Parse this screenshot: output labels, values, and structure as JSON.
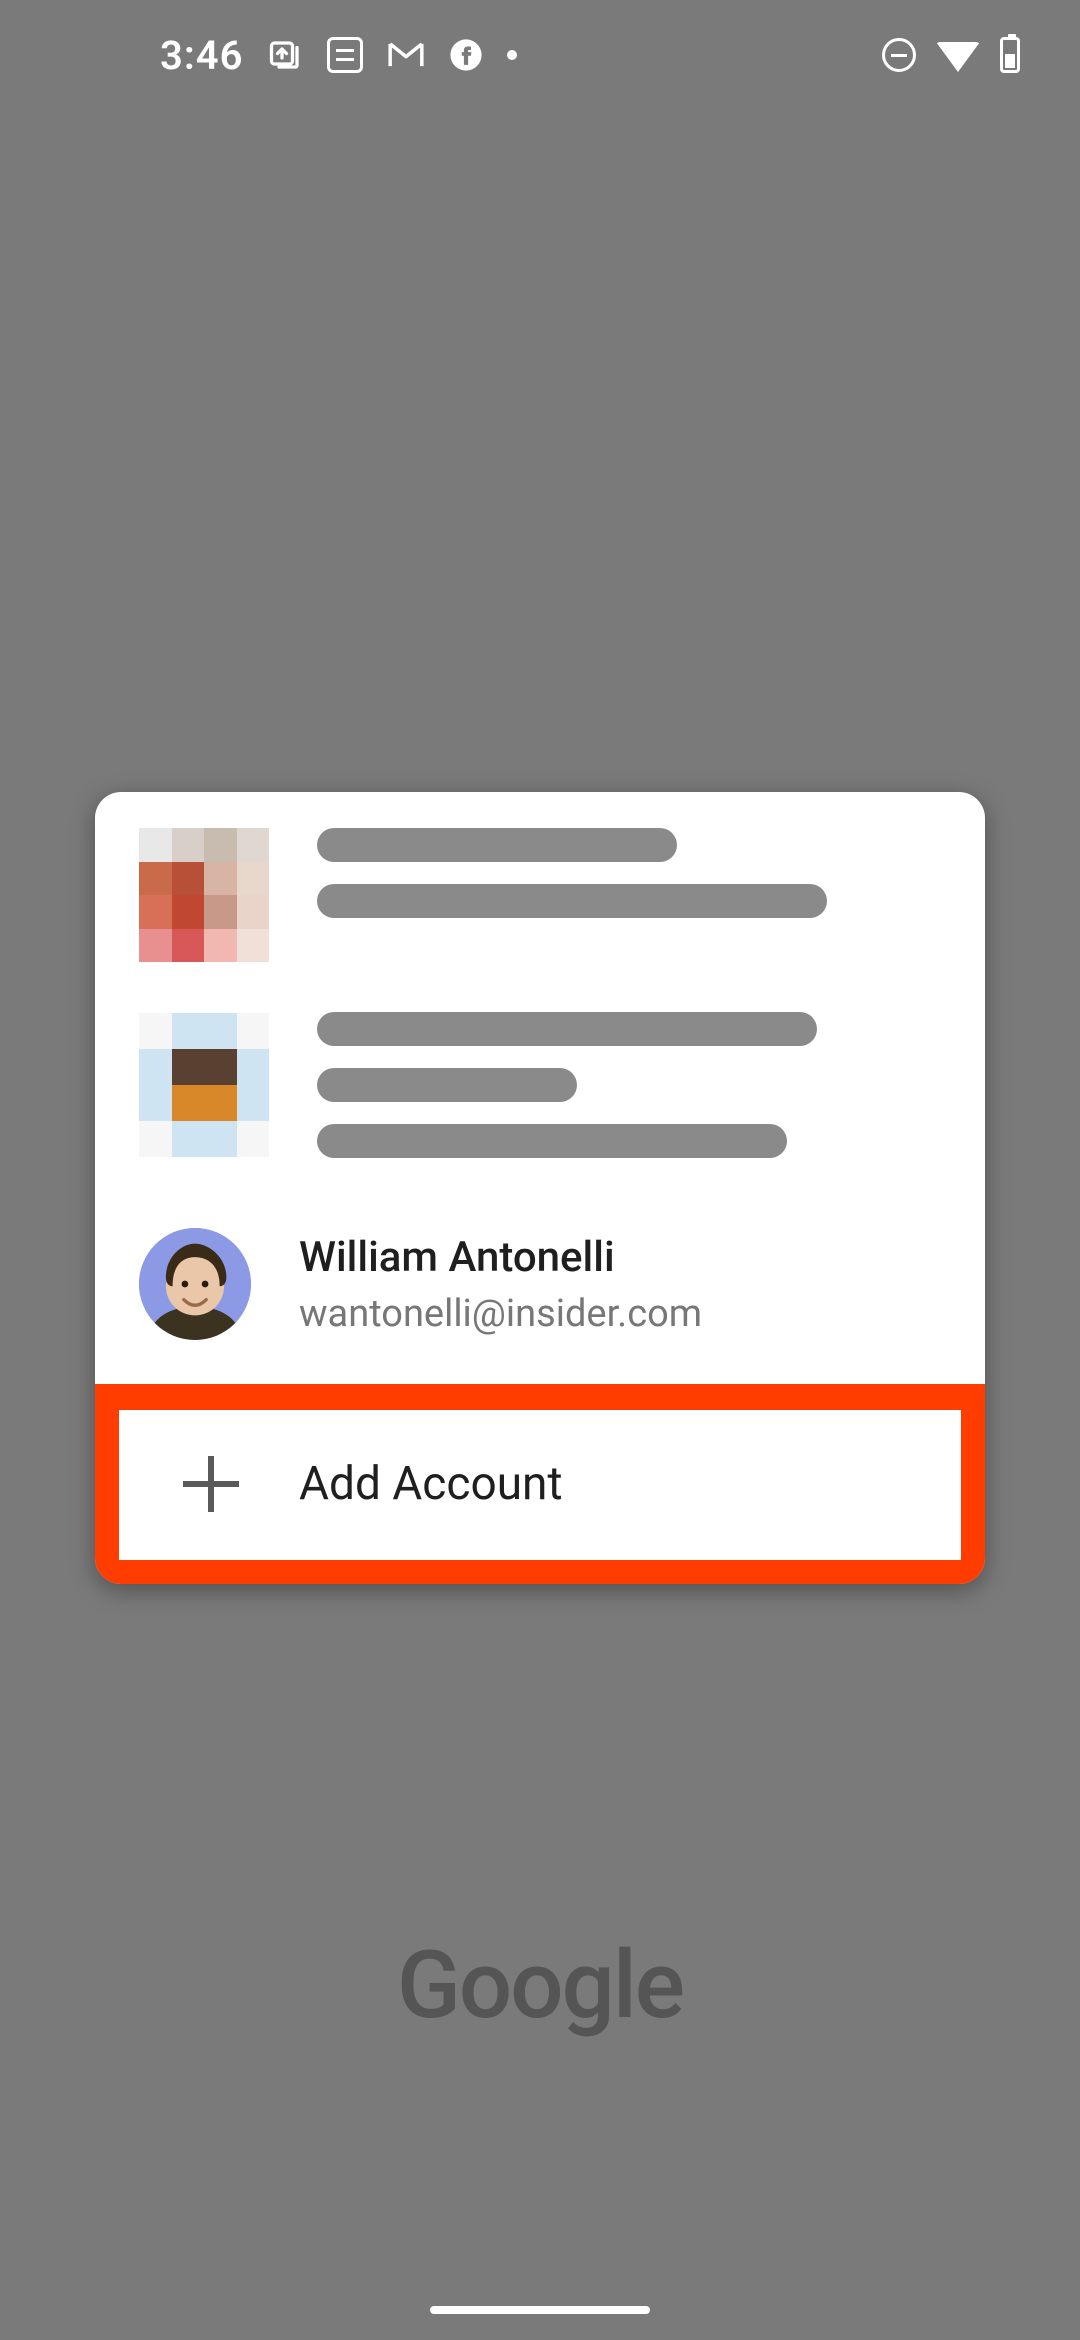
{
  "status": {
    "time": "3:46"
  },
  "accounts": [
    {
      "name_redacted": true,
      "email_redacted": true
    },
    {
      "name_redacted": true,
      "email_redacted": true
    },
    {
      "name": "William Antonelli",
      "email": "wantonelli@insider.com"
    }
  ],
  "add_account_label": "Add Account",
  "brand": "Google",
  "highlight_color": "#ff3d00"
}
